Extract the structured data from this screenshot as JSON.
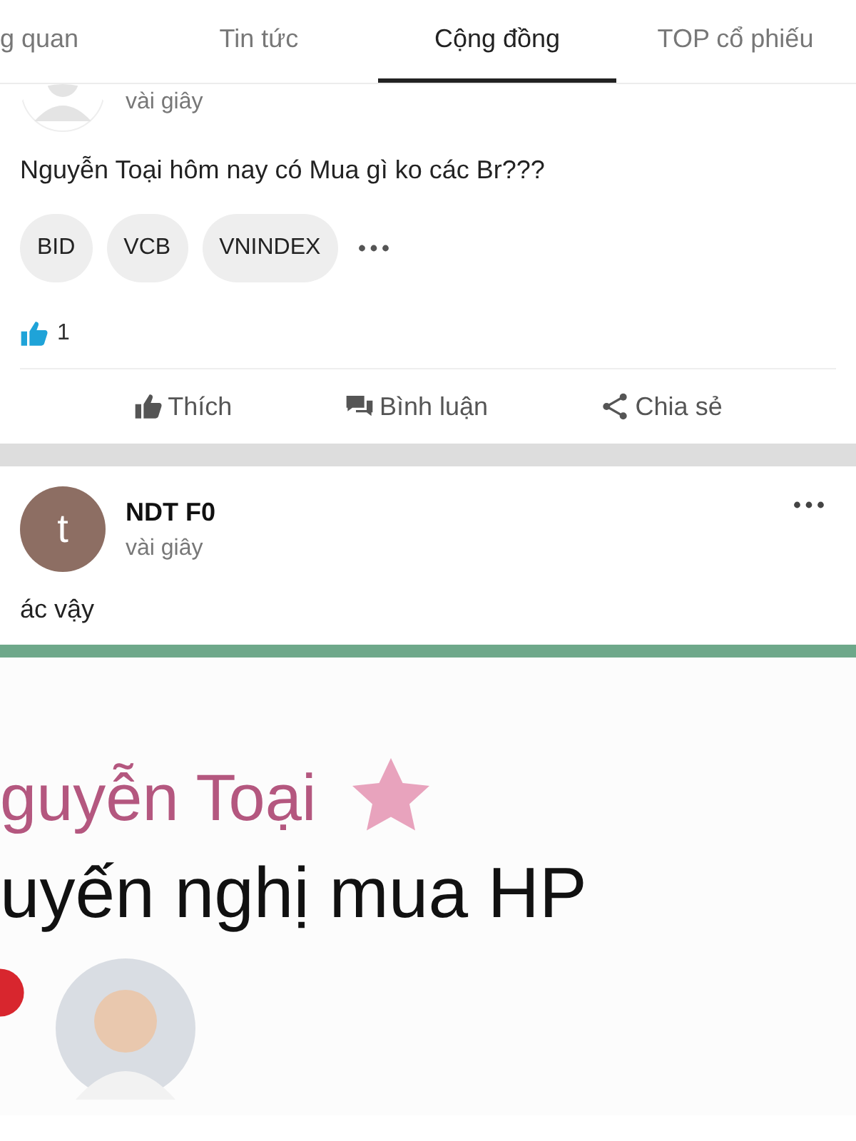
{
  "tabs": [
    {
      "label": "g quan",
      "selected": false
    },
    {
      "label": "Tin tức",
      "selected": false
    },
    {
      "label": "Cộng đồng",
      "selected": true
    },
    {
      "label": "TOP cổ phiếu",
      "selected": false
    }
  ],
  "posts": [
    {
      "time": "vài giây",
      "text": "Nguyễn Toại hôm nay có Mua gì ko các Br???",
      "tags": [
        "BID",
        "VCB",
        "VNINDEX"
      ],
      "likes": "1",
      "actions": [
        {
          "kind": "like",
          "label": "Thích"
        },
        {
          "kind": "comment",
          "label": "Bình luận"
        },
        {
          "kind": "share",
          "label": "Chia sẻ"
        }
      ]
    },
    {
      "author": "NDT F0",
      "avatar_letter": "t",
      "time": "vài giây",
      "text": "ác vậy",
      "image": {
        "name": "guyễn Toại",
        "line": "uyến nghị mua HP"
      }
    }
  ]
}
